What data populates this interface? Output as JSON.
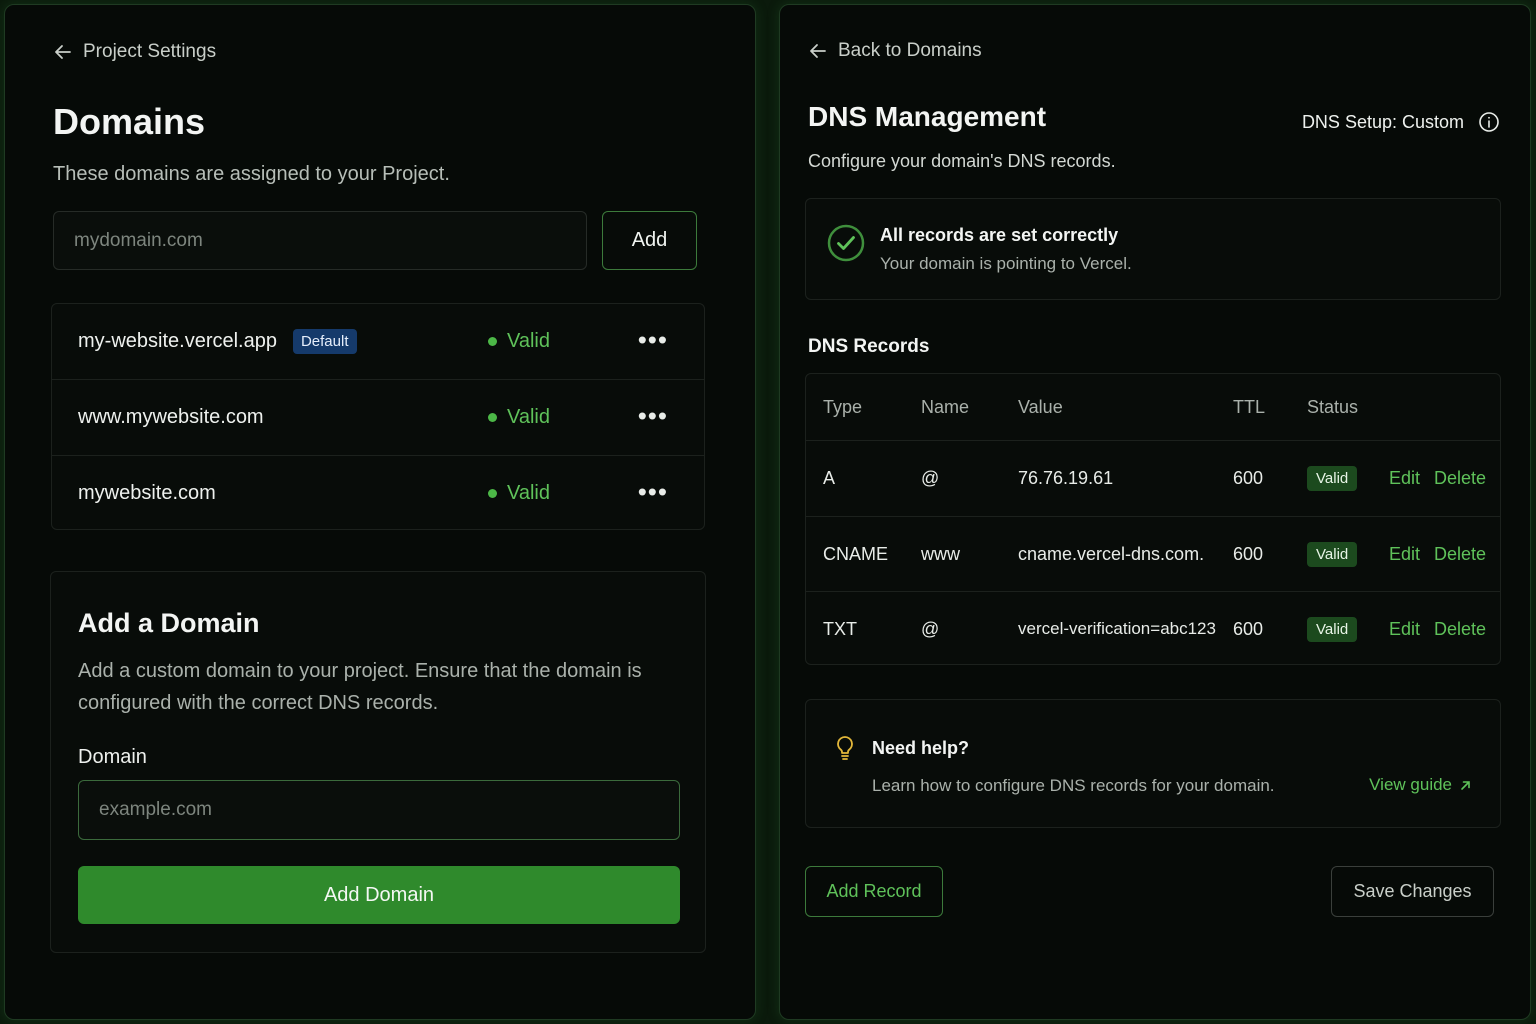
{
  "left": {
    "back_label": "Project Settings",
    "title": "Domains",
    "subtitle": "These domains are assigned to your Project.",
    "domain_input_placeholder": "mydomain.com",
    "add_button": "Add",
    "domains": [
      {
        "name": "my-website.vercel.app",
        "badge": "Default",
        "status": "Valid"
      },
      {
        "name": "www.mywebsite.com",
        "badge": "",
        "status": "Valid"
      },
      {
        "name": "mywebsite.com",
        "badge": "",
        "status": "Valid"
      }
    ],
    "add_domain_card": {
      "title": "Add a Domain",
      "description_line1": "Add a custom domain to your project. Ensure that the domain is",
      "description_line2": "configured with the correct DNS records.",
      "field_label": "Domain",
      "field_placeholder": "example.com",
      "submit_button": "Add Domain"
    }
  },
  "right": {
    "back_label": "Back to Domains",
    "title": "DNS Management",
    "dns_setup_label": "DNS Setup: Custom",
    "subtitle": "Configure your domain's DNS records.",
    "status_card": {
      "title": "All records are set correctly",
      "message": "Your domain is pointing to Vercel."
    },
    "records_heading": "DNS Records",
    "table": {
      "headers": [
        "Type",
        "Name",
        "Value",
        "TTL",
        "Status"
      ],
      "rows": [
        {
          "type": "A",
          "name": "@",
          "value": "76.76.19.61",
          "ttl": "600",
          "status": "Valid",
          "edit": "Edit",
          "delete": "Delete"
        },
        {
          "type": "CNAME",
          "name": "www",
          "value": "cname.vercel-dns.com.",
          "ttl": "600",
          "status": "Valid",
          "edit": "Edit",
          "delete": "Delete"
        },
        {
          "type": "TXT",
          "name": "@",
          "value": "vercel-verification=abc123",
          "ttl": "600",
          "status": "Valid",
          "edit": "Edit",
          "delete": "Delete"
        }
      ]
    },
    "help_card": {
      "title": "Need help?",
      "message": "Learn how to configure DNS records for your domain.",
      "link": "View guide"
    },
    "add_record_button": "Add Record",
    "save_button": "Save Changes"
  },
  "colors": {
    "accent_green": "#5fc25a",
    "primary_button": "#2f8a2c",
    "default_badge": "#153a6b"
  }
}
